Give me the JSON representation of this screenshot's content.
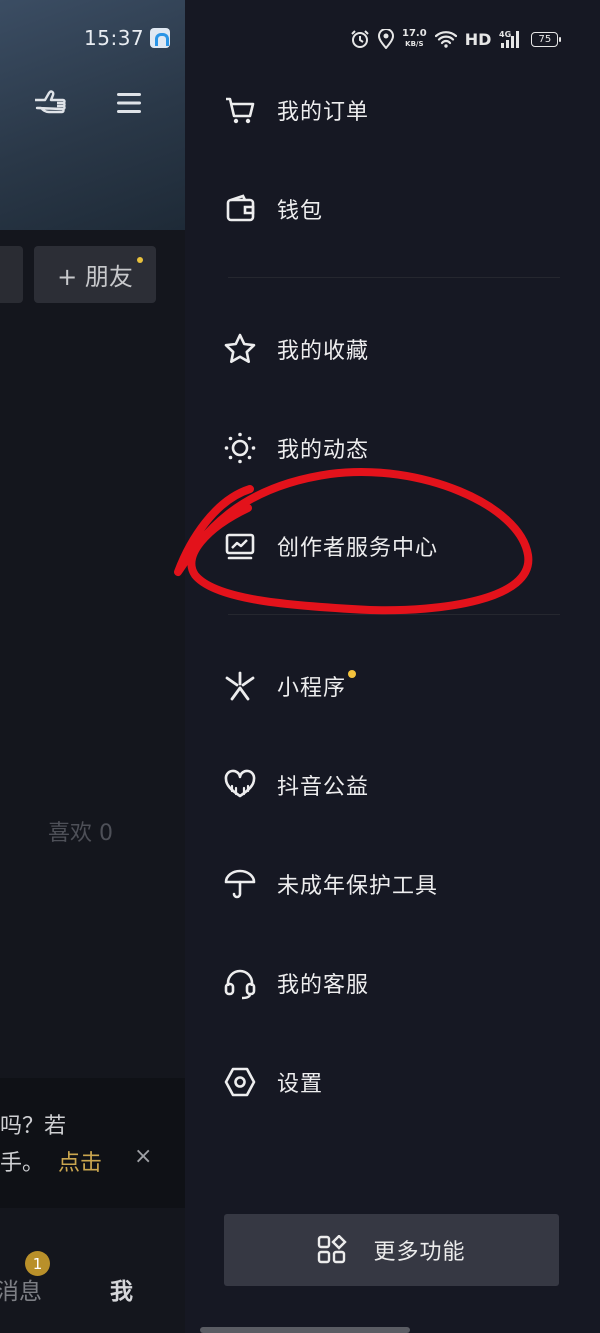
{
  "status_bar": {
    "time": "15:37",
    "net_speed_value": "17.0",
    "net_speed_unit": "KB/S",
    "hd": "HD",
    "signal": "4G",
    "battery": "75"
  },
  "profile_page": {
    "add_friend": "+ 朋友",
    "likes": "喜欢 0",
    "notice_line1": "吗？若",
    "notice_line2": "手。",
    "notice_link": "点击",
    "notice_close": "×",
    "tab_messages": "消息",
    "tab_messages_badge": "1",
    "tab_me": "我"
  },
  "drawer": {
    "items": [
      {
        "label": "我的订单",
        "icon": "cart-icon"
      },
      {
        "label": "钱包",
        "icon": "wallet-icon"
      },
      {
        "label": "我的收藏",
        "icon": "star-icon"
      },
      {
        "label": "我的动态",
        "icon": "sun-icon"
      },
      {
        "label": "创作者服务中心",
        "icon": "creator-chart-icon"
      },
      {
        "label": "小程序",
        "icon": "mini-program-icon"
      },
      {
        "label": "抖音公益",
        "icon": "charity-heart-icon"
      },
      {
        "label": "未成年保护工具",
        "icon": "umbrella-icon"
      },
      {
        "label": "我的客服",
        "icon": "headset-icon"
      },
      {
        "label": "设置",
        "icon": "settings-hex-icon"
      }
    ],
    "more_button": "更多功能"
  },
  "colors": {
    "drawer_bg": "#161823",
    "annotation": "#e3121b",
    "badge_dot": "#f3c23c"
  }
}
